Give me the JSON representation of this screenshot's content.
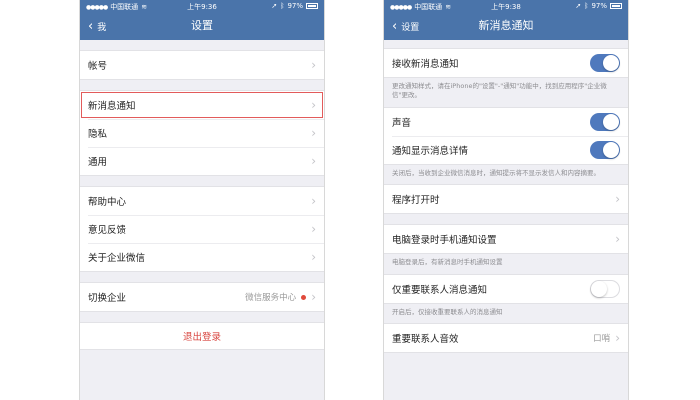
{
  "left": {
    "status": {
      "carrier": "中国联通",
      "time": "上午9:36",
      "battery": "97%"
    },
    "nav": {
      "back_label": "我",
      "title": "设置"
    },
    "rows": {
      "account": "帐号",
      "new_message_notify": "新消息通知",
      "privacy": "隐私",
      "general": "通用",
      "help": "帮助中心",
      "feedback": "意见反馈",
      "about": "关于企业微信",
      "switch_company": "切换企业",
      "switch_company_value": "微信服务中心"
    },
    "logout": "退出登录",
    "colors": {
      "nav": "#4a74aa",
      "highlight": "#e25b5b",
      "logout": "#d8453f",
      "badge": "#e04a3c"
    }
  },
  "right": {
    "status": {
      "carrier": "中国联通",
      "time": "上午9:38",
      "battery": "97%"
    },
    "nav": {
      "back_label": "设置",
      "title": "新消息通知"
    },
    "receive": {
      "label": "接收新消息通知",
      "toggle": true
    },
    "receive_hint": "更改通知样式，请在iPhone的\"设置\"-\"通知\"功能中，找到应用程序\"企业微信\"更改。",
    "sound": {
      "label": "声音",
      "toggle": true
    },
    "show_detail": {
      "label": "通知显示消息详情",
      "toggle": true
    },
    "detail_hint": "关闭后，当收到企业微信消息时，通知提示将不显示发信人和内容摘要。",
    "program_open": {
      "label": "程序打开时"
    },
    "pc_login": {
      "label": "电脑登录时手机通知设置"
    },
    "pc_hint": "电脑登录后，有新消息时手机通知设置",
    "important_only": {
      "label": "仅重要联系人消息通知",
      "toggle": false
    },
    "important_hint": "开启后，仅接收重要联系人的消息通知",
    "important_sound": {
      "label": "重要联系人音效",
      "value": "口哨"
    },
    "colors": {
      "toggle_on": "#4f79bd"
    }
  }
}
